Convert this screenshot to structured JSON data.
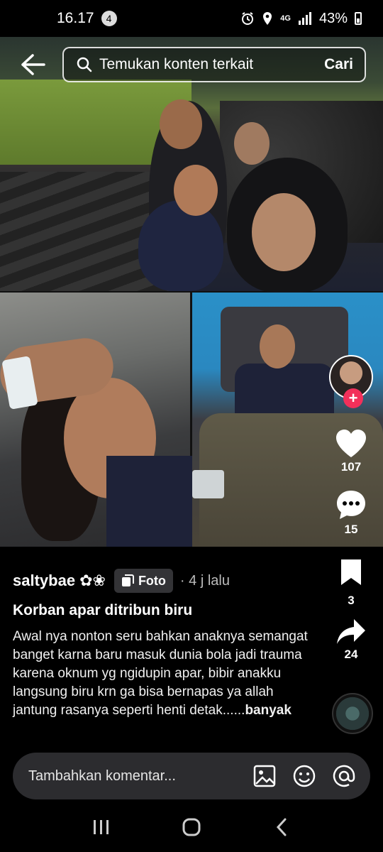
{
  "status_bar": {
    "time": "16.17",
    "notification_count": "4",
    "network": "4G",
    "battery": "43%"
  },
  "search": {
    "placeholder": "Temukan konten terkait",
    "button_label": "Cari"
  },
  "post": {
    "username": "saltybae",
    "username_decoration": "✿❀",
    "type_badge": "Foto",
    "time_ago": "· 4 j lalu",
    "title": "Korban apar ditribun biru",
    "description": "Awal nya nonton seru bahkan anaknya semangat banget karna baru masuk dunia bola jadi trauma karena oknum yg ngidupin apar, bibir anakku langsung biru krn ga bisa bernapas ya allah jantung rasanya seperti henti detak......",
    "more_label": "banyak"
  },
  "actions": {
    "likes": "107",
    "comments": "15",
    "saves": "3",
    "shares": "24"
  },
  "comment_bar": {
    "placeholder": "Tambahkan komentar..."
  },
  "icons": {
    "back": "back-arrow-icon",
    "search": "search-icon",
    "heart": "heart-icon",
    "comment": "comment-icon",
    "bookmark": "bookmark-icon",
    "share": "share-icon",
    "image": "image-icon",
    "emoji": "emoji-icon",
    "mention": "mention-icon"
  },
  "colors": {
    "follow_accent": "#f2305a",
    "background": "#000000",
    "comment_bar": "#2c2c2f"
  }
}
